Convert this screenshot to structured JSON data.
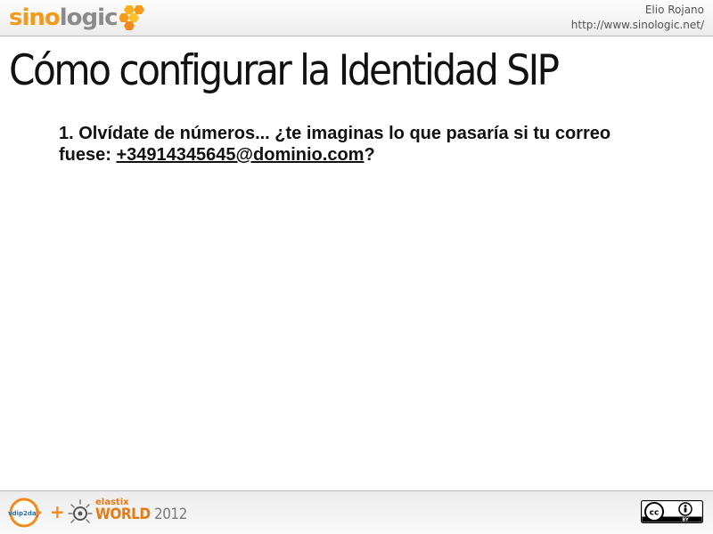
{
  "header": {
    "logo": {
      "part1": "sino",
      "part2": "logic"
    },
    "author_name": "Elio Rojano",
    "author_url": "http://www.sinologic.net/"
  },
  "slide": {
    "title": "Cómo configurar la Identidad SIP",
    "point_1_text": "1. Olvídate de números... ¿te imaginas lo que pasaría si tu correo fuese: ",
    "point_1_email": "+34914345645@dominio.com",
    "point_1_end": "?"
  },
  "footer": {
    "vd_logo_text": "vdip2day",
    "plus_sign": "+",
    "event_line1": "elastix",
    "event_world": "WORLD",
    "event_year": " 2012",
    "cc_text": "cc",
    "by_text": "BY"
  },
  "colors": {
    "brand_orange": "#f39a1c",
    "brand_gray": "#8a8a8a"
  },
  "icons": [
    "hexagon-logo-icon",
    "voip2day-logo-icon",
    "elastix-gear-icon",
    "creative-commons-icon",
    "attribution-person-icon"
  ]
}
